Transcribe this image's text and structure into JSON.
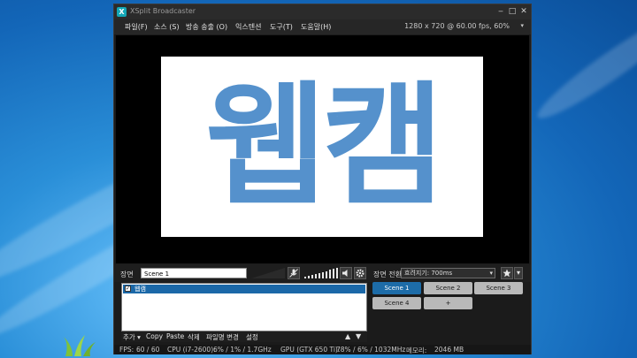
{
  "window": {
    "title": "XSplit Broadcaster",
    "minimize": "‒",
    "maximize": "□",
    "close": "✕"
  },
  "menu": {
    "items": [
      "파일(F)",
      "소스 (S)",
      "방송 송출 (O)",
      "익스텐션",
      "도구(T)",
      "도움말(H)"
    ],
    "resolution": "1280 x 720 @ 60.00 fps, 60%",
    "caret": "▾"
  },
  "preview": {
    "text": "웹캠",
    "text_color": "#5591cc"
  },
  "scene": {
    "label": "장면",
    "name": "Scene 1",
    "transition_label": "장면 전환",
    "transition_value": "흐려지기: 700ms",
    "caret": "▾"
  },
  "sources": {
    "items": [
      {
        "label": "웹캠",
        "checked": true
      }
    ],
    "toolbar": {
      "add": "추가 ▾",
      "copy": "Copy",
      "paste": "Paste",
      "delete": "삭제",
      "rename": "파일명 변경",
      "settings": "설정",
      "up": "▲",
      "down": "▼"
    }
  },
  "scenes": {
    "buttons": [
      "Scene 1",
      "Scene 2",
      "Scene 3",
      "Scene 4",
      "+"
    ],
    "active_index": 0,
    "active_color": "#1d6ca8"
  },
  "status": {
    "fps_label": "FPS:",
    "fps_value": "60 / 60",
    "cpu_label": "CPU (i7-2600):",
    "cpu_value": "6% / 1% / 1.7GHz",
    "gpu_label": "GPU (GTX 650 Ti):",
    "gpu_value": "78% / 6% / 1032MHz",
    "mem_label": "메모리:",
    "mem_value": "2046 MB"
  },
  "icons": {
    "app": "xsplit-logo-icon",
    "mic": "mic-muted-icon",
    "speaker": "speaker-icon",
    "gear": "gear-icon",
    "transition": "transition-star-icon"
  }
}
